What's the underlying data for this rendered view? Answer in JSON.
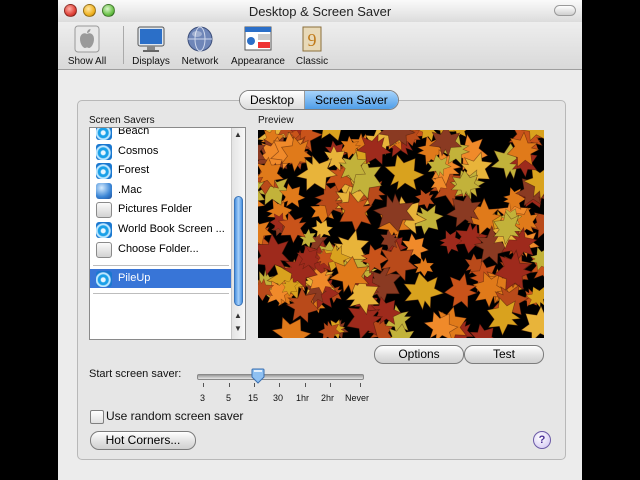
{
  "window": {
    "title": "Desktop & Screen Saver"
  },
  "toolbar": {
    "items": [
      {
        "label": "Show All",
        "icon": "apple-icon"
      },
      {
        "label": "Displays",
        "icon": "display-icon"
      },
      {
        "label": "Network",
        "icon": "network-globe-icon"
      },
      {
        "label": "Appearance",
        "icon": "appearance-icon"
      },
      {
        "label": "Classic",
        "icon": "classic-icon"
      }
    ]
  },
  "tabs": [
    {
      "label": "Desktop",
      "selected": false
    },
    {
      "label": "Screen Saver",
      "selected": true
    }
  ],
  "screen_savers": {
    "heading": "Screen Savers",
    "items": [
      {
        "label": "Beach",
        "icon": "screen-saver-icon"
      },
      {
        "label": "Cosmos",
        "icon": "screen-saver-icon"
      },
      {
        "label": "Forest",
        "icon": "screen-saver-icon"
      },
      {
        "label": ".Mac",
        "icon": "dotmac-icon"
      },
      {
        "label": "Pictures Folder",
        "icon": "folder-icon"
      },
      {
        "label": "World Book Screen ...",
        "icon": "screen-saver-icon"
      },
      {
        "label": "Choose Folder...",
        "icon": "folder-icon"
      },
      {
        "label": "PileUp",
        "icon": "screen-saver-icon",
        "selected": true
      }
    ]
  },
  "preview": {
    "heading": "Preview"
  },
  "buttons": {
    "options": "Options",
    "test": "Test",
    "hot_corners": "Hot Corners..."
  },
  "start": {
    "label": "Start screen saver:",
    "ticks": [
      "3",
      "5",
      "15",
      "30",
      "1hr",
      "2hr",
      "Never"
    ],
    "selected": "15"
  },
  "random": {
    "label": "Use random screen saver",
    "checked": false
  },
  "help": {
    "label": "?"
  },
  "colors": {
    "selection": "#3875d7",
    "tab_selected": "#4f9de8"
  }
}
